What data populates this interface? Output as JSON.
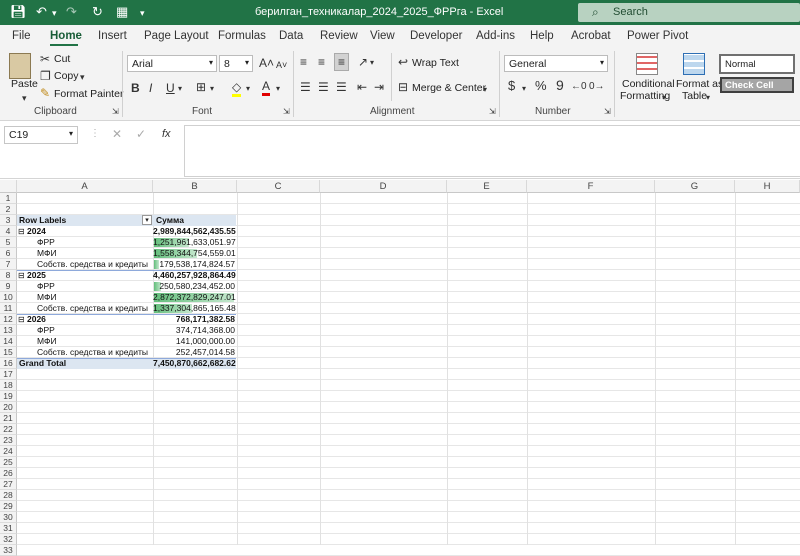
{
  "titlebar": {
    "title": "берилган_техникалар_2024_2025_ФРРга  -  Excel",
    "search_placeholder": "Search",
    "colors": {
      "bg": "#217346"
    }
  },
  "tabs": [
    "File",
    "Home",
    "Insert",
    "Page Layout",
    "Formulas",
    "Data",
    "Review",
    "View",
    "Developer",
    "Add-ins",
    "Help",
    "Acrobat",
    "Power Pivot"
  ],
  "active_tab": "Home",
  "ribbon": {
    "clipboard": {
      "paste": "Paste",
      "cut": "Cut",
      "copy": "Copy",
      "format_painter": "Format Painter",
      "label": "Clipboard"
    },
    "font": {
      "name": "Arial",
      "size": "8",
      "label": "Font"
    },
    "alignment": {
      "wrap_text": "Wrap Text",
      "merge_center": "Merge & Center",
      "label": "Alignment"
    },
    "number": {
      "format": "General",
      "label": "Number",
      "currency": "$",
      "percent": "%",
      "comma": "9"
    },
    "styles": {
      "conditional": "Conditional",
      "formatting": "Formatting",
      "format_as": "Format as",
      "table": "Table",
      "normal": "Normal",
      "check_cell": "Check Cell"
    }
  },
  "formula_bar": {
    "name_box": "C19",
    "fx": "fx",
    "content": ""
  },
  "columns": [
    "A",
    "B",
    "C",
    "D",
    "E",
    "F",
    "G",
    "H"
  ],
  "rows": [
    "1",
    "2",
    "3",
    "4",
    "5",
    "6",
    "7",
    "8",
    "9",
    "10",
    "11",
    "12",
    "13",
    "14",
    "15",
    "16",
    "17",
    "18",
    "19",
    "20",
    "21",
    "22",
    "23",
    "24",
    "25",
    "26",
    "27",
    "28",
    "29",
    "30",
    "31",
    "32",
    "33"
  ],
  "pivot": {
    "header_labels": "Row Labels",
    "header_sum": "Сумма",
    "rows": [
      {
        "label": "2024",
        "value": "2,989,844,562,435.55",
        "level": 0,
        "bar": 0
      },
      {
        "label": "ФРР",
        "value": "1,251,961,633,051.97",
        "level": 1,
        "bar": 0.44
      },
      {
        "label": "МФИ",
        "value": "1,558,344,754,559.01",
        "level": 1,
        "bar": 0.54
      },
      {
        "label": "Собств. средства и кредиты",
        "value": "179,538,174,824.57",
        "level": 1,
        "bar": 0.06
      },
      {
        "label": "2025",
        "value": "4,460,257,928,864.49",
        "level": 0,
        "bar": 0
      },
      {
        "label": "ФРР",
        "value": "250,580,234,452.00",
        "level": 1,
        "bar": 0.09
      },
      {
        "label": "МФИ",
        "value": "2,872,372,829,247.01",
        "level": 1,
        "bar": 1.0
      },
      {
        "label": "Собств. средства и кредиты",
        "value": "1,337,304,865,165.48",
        "level": 1,
        "bar": 0.47
      },
      {
        "label": "2026",
        "value": "768,171,382.58",
        "level": 0,
        "bar": 0
      },
      {
        "label": "ФРР",
        "value": "374,714,368.00",
        "level": 1,
        "bar": 0
      },
      {
        "label": "МФИ",
        "value": "141,000,000.00",
        "level": 1,
        "bar": 0
      },
      {
        "label": "Собств. средства и кредиты",
        "value": "252,457,014.58",
        "level": 1,
        "bar": 0
      }
    ],
    "grand_total_label": "Grand Total",
    "grand_total_value": "7,450,870,662,682.62"
  }
}
